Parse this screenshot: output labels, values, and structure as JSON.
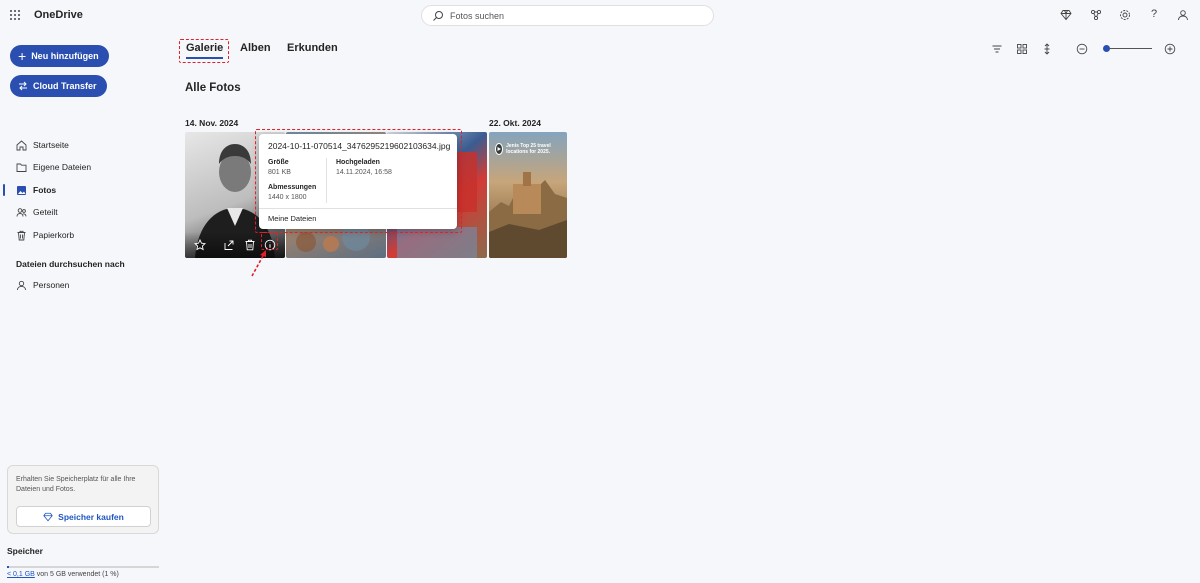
{
  "app": {
    "title": "OneDrive"
  },
  "search": {
    "placeholder": "Fotos suchen"
  },
  "topbar": {
    "help": "?"
  },
  "sidebar": {
    "new_button": "Neu hinzufügen",
    "cloud_transfer_button": "Cloud Transfer",
    "items": [
      {
        "label": "Startseite",
        "icon": "home-icon",
        "active": false
      },
      {
        "label": "Eigene Dateien",
        "icon": "folder-icon",
        "active": false
      },
      {
        "label": "Fotos",
        "icon": "photos-icon",
        "active": true
      },
      {
        "label": "Geteilt",
        "icon": "people-icon",
        "active": false
      },
      {
        "label": "Papierkorb",
        "icon": "trash-icon",
        "active": false
      }
    ],
    "browse_section": "Dateien durchsuchen nach",
    "browse_items": [
      {
        "label": "Personen",
        "icon": "person-icon"
      }
    ],
    "promo": {
      "text": "Erhalten Sie Speicherplatz für alle Ihre Dateien und Fotos.",
      "button": "Speicher kaufen"
    },
    "storage": {
      "title": "Speicher",
      "used_link": "< 0,1 GB",
      "used_rest": " von 5 GB verwendet (1 %)",
      "fraction": 0.01
    }
  },
  "tabs": [
    {
      "label": "Galerie",
      "active": true
    },
    {
      "label": "Alben",
      "active": false
    },
    {
      "label": "Erkunden",
      "active": false
    }
  ],
  "main": {
    "section_title": "Alle Fotos",
    "groups": [
      {
        "date": "14. Nov. 2024"
      },
      {
        "date": "22. Okt. 2024"
      }
    ],
    "video_caption": "Jenis Top 25 travel locations for 2025."
  },
  "tooltip": {
    "filename": "2024-10-11-070514_3476295219602103634.jpg",
    "size_label": "Größe",
    "size_value": "801 KB",
    "uploaded_label": "Hochgeladen",
    "uploaded_value": "14.11.2024, 16:58",
    "dimensions_label": "Abmessungen",
    "dimensions_value": "1440 x 1800",
    "location": "Meine Dateien"
  },
  "colors": {
    "accent": "#2a4fb0",
    "annotation": "#e0202a",
    "link": "#1f56c2"
  }
}
